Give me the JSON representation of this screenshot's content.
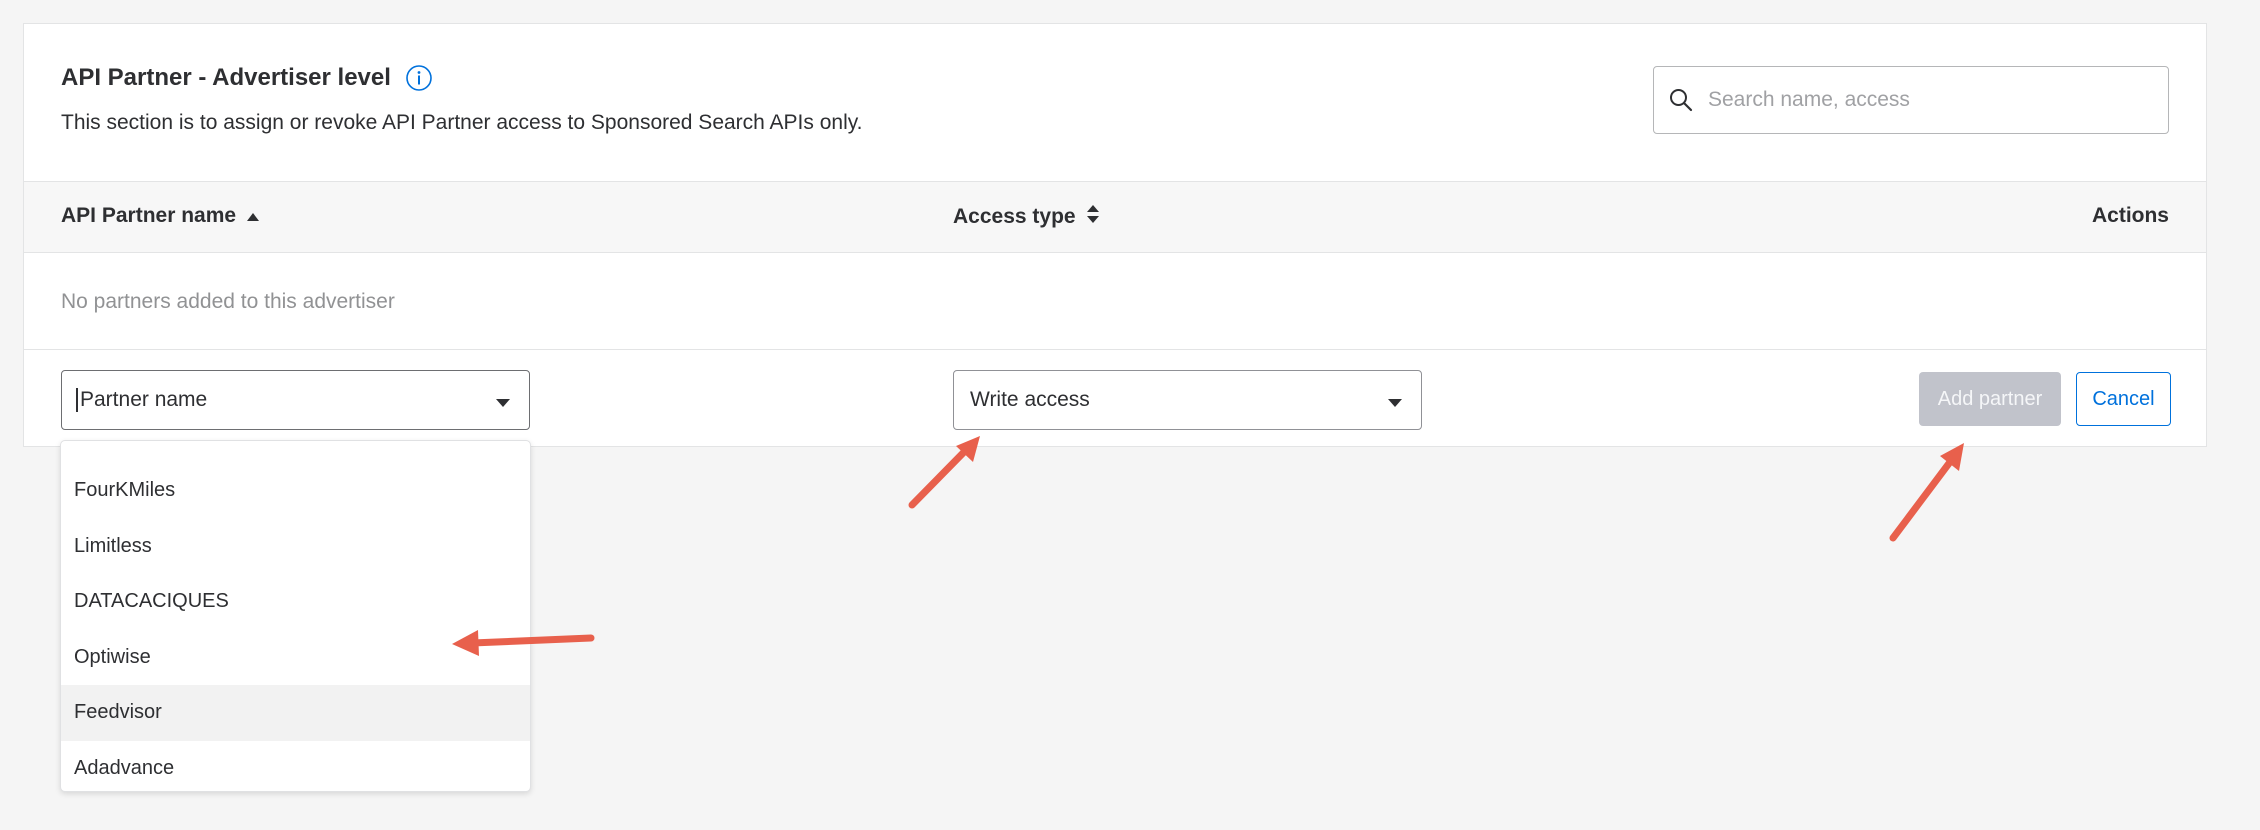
{
  "panel": {
    "title": "API Partner - Advertiser level",
    "subtitle": "This section is to assign or revoke API Partner access to Sponsored Search APIs only.",
    "search_placeholder": "Search name, access"
  },
  "table": {
    "columns": [
      "API Partner name",
      "Access type",
      "Actions"
    ],
    "empty_message": "No partners added to this advertiser"
  },
  "form": {
    "partner_placeholder": "Partner name",
    "access_value": "Write access",
    "add_label": "Add partner",
    "cancel_label": "Cancel"
  },
  "dropdown": {
    "options": [
      "FourKMiles",
      "Limitless",
      "DATACACIQUES",
      "Optiwise",
      "Feedvisor",
      "Adadvance"
    ],
    "highlighted": "Feedvisor"
  },
  "colors": {
    "accent": "#0071dc",
    "disabled_button": "#c1c3cb",
    "annotation_arrow": "#e8604c"
  },
  "icons": {
    "info": "info-icon",
    "search": "search-icon",
    "sort_asc": "sort-ascending-icon",
    "sort_both": "sort-icon",
    "chevron": "chevron-down-icon"
  }
}
